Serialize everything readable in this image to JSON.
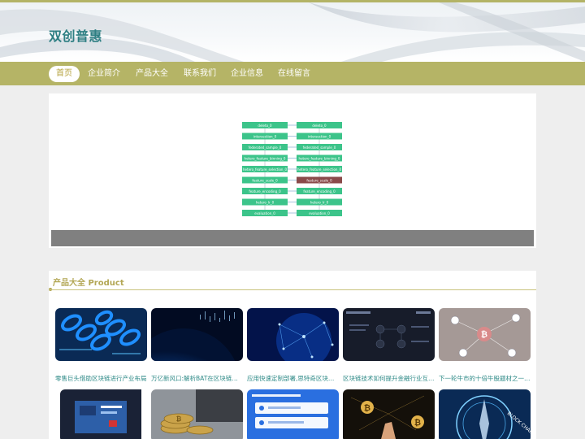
{
  "site": {
    "title": "双创普惠"
  },
  "nav": {
    "items": [
      {
        "label": "首页",
        "active": true
      },
      {
        "label": "企业简介",
        "active": false
      },
      {
        "label": "产品大全",
        "active": false
      },
      {
        "label": "联系我们",
        "active": false
      },
      {
        "label": "企业信息",
        "active": false
      },
      {
        "label": "在线留言",
        "active": false
      }
    ]
  },
  "banner": {
    "diagram": {
      "left": [
        "deleto_0",
        "intersection_0",
        "federated_sample_0",
        "hetero_feature_binning_0",
        "hetero_feature_selection_0",
        "feature_scale_0",
        "feature_encoding_0",
        "hetero_lr_0",
        "evaluation_0"
      ],
      "right": [
        "deleto_0",
        "intersection_0",
        "federated_sample_0",
        "hetero_feature_binning_0",
        "hetero_feature_selection_0",
        "feature_scale_0",
        "feature_encoding_0",
        "hetero_lr_0",
        "evaluation_0"
      ],
      "node_color": "#3cc48a",
      "highlight_color": "#8a4a4a"
    }
  },
  "products": {
    "heading": "产品大全 Product",
    "accent_color": "#b3a755",
    "items": [
      {
        "caption": "零售巨头借助区块链进行产业布局",
        "image": "blue-chain-links"
      },
      {
        "caption": "万亿新风口:解析BAT在区块链领域布局",
        "image": "earth-digital-grid"
      },
      {
        "caption": "应用快速定制部署,思特奇区块链平台",
        "image": "blue-network-globe"
      },
      {
        "caption": "区块链技术如何提升金融行业互信水平",
        "image": "dark-flowchart-slide"
      },
      {
        "caption": "下一轮牛市的十倍牛股题材之一:区块链",
        "image": "hand-bitcoin-network"
      },
      {
        "caption": "",
        "image": "presentation-screen"
      },
      {
        "caption": "",
        "image": "bitcoin-coins-laptop"
      },
      {
        "caption": "",
        "image": "blue-slide-ui"
      },
      {
        "caption": "",
        "image": "hand-bitcoin-glow"
      },
      {
        "caption": "",
        "image": "block-chain-compass"
      }
    ]
  }
}
